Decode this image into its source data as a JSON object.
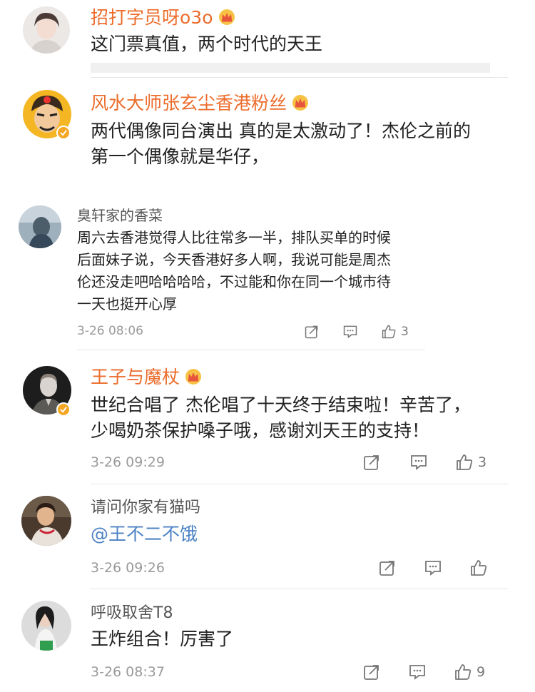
{
  "comments": [
    {
      "user": "招打字员呀o3o",
      "text": "这门票真值，两个时代的天王"
    },
    {
      "user": "风水大师张玄尘香港粉丝",
      "text": "两代偶像同台演出 真的是太激动了！杰伦之前的\n第一个偶像就是华仔，"
    },
    {
      "user": "臭轩家的香菜",
      "text": "周六去香港觉得人比往常多一半，排队买单的时候\n后面妹子说，今天香港好多人啊，我说可能是周杰\n伦还没走吧哈哈哈哈，不过能和你在同一个城市待\n一天也挺开心厚",
      "time": "3-26 08:06",
      "likes": "3"
    },
    {
      "user": "王子与魔杖",
      "text": "世纪合唱了 杰伦唱了十天终于结束啦！辛苦了，\n少喝奶茶保护嗓子哦，感谢刘天王的支持！",
      "time": "3-26 09:29",
      "likes": "3"
    },
    {
      "user": "请问你家有猫吗",
      "text": "@王不二不饿",
      "time": "3-26 09:26",
      "likes": ""
    },
    {
      "user": "呼吸取舍T8",
      "text": "王炸组合！厉害了",
      "time": "3-26 08:37",
      "likes": "9"
    }
  ],
  "icons": {
    "crown": "vip-crown-icon",
    "forward": "forward-icon",
    "comment": "comment-icon",
    "like": "thumbs-up-icon",
    "verified": "verified-badge-icon"
  },
  "colors": {
    "vip_name": "#ec6c2b",
    "mention": "#4c82c4",
    "timestamp": "#9a9a9a",
    "divider": "#e6e6e6"
  }
}
